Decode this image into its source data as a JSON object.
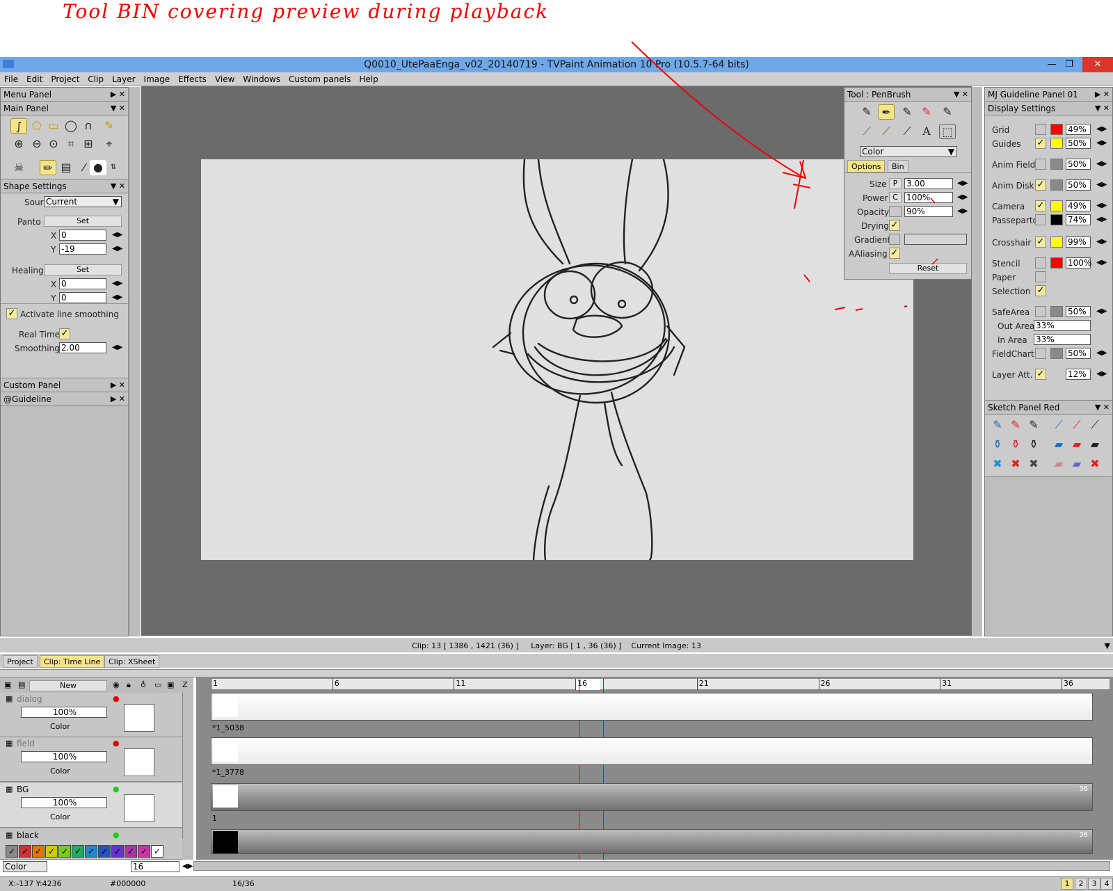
{
  "annotation": {
    "text": "Tool BIN covering preview during playback"
  },
  "window": {
    "title": "Q0010_UtePaaEnga_v02_20140719 - TVPaint Animation 10 Pro (10.5.7-64 bits)",
    "minimize": "—",
    "restore": "❐",
    "close": "✕"
  },
  "menu": [
    "File",
    "Edit",
    "Project",
    "Clip",
    "Layer",
    "Image",
    "Effects",
    "View",
    "Windows",
    "Custom panels",
    "Help"
  ],
  "left": {
    "menu_panel": "Menu Panel",
    "main_panel": "Main Panel",
    "shape_settings": "Shape Settings",
    "source_label": "Source",
    "source_value": "Current",
    "panto_label": "Panto",
    "panto_set": "Set",
    "panto_x": "0",
    "panto_y": "-19",
    "healing_label": "Healing",
    "healing_set": "Set",
    "healing_x": "0",
    "healing_y": "0",
    "x_label": "X",
    "y_label": "Y",
    "line_smoothing": "Activate line smoothing",
    "real_time": "Real Time",
    "smoothing_label": "Smoothing",
    "smoothing_value": "2.00",
    "custom_panel": "Custom Panel",
    "guideline": "@Guideline"
  },
  "tool_panel": {
    "title": "Tool : PenBrush",
    "mode": "Color",
    "tab_options": "Options",
    "tab_bin": "Bin",
    "size_label": "Size",
    "size_mode": "P",
    "size_value": "3.00",
    "power_label": "Power",
    "power_mode": "C",
    "power_value": "100%",
    "opacity_label": "Opacity",
    "opacity_value": "90%",
    "drying_label": "Drying",
    "gradient_label": "Gradient",
    "aaliasing_label": "AAliasing",
    "reset": "Reset"
  },
  "right": {
    "title": "MJ Guideline Panel 01",
    "display_settings": "Display Settings",
    "rows": [
      {
        "label": "Grid",
        "value": "49%",
        "color": "#ff0000"
      },
      {
        "label": "Guides",
        "value": "50%",
        "color": "#ffff00"
      },
      {
        "label": "Anim Field",
        "value": "50%",
        "color": "#8a8a8a"
      },
      {
        "label": "Anim Disk",
        "value": "50%",
        "color": "#8a8a8a"
      },
      {
        "label": "Camera",
        "value": "49%",
        "color": "#ffff00"
      },
      {
        "label": "Passepartout",
        "value": "74%",
        "color": "#000000"
      },
      {
        "label": "Crosshair",
        "value": "99%",
        "color": "#ffff00"
      },
      {
        "label": "Stencil",
        "value": "100%",
        "color": "#ff0000"
      },
      {
        "label": "Paper",
        "value": ""
      },
      {
        "label": "Selection",
        "value": ""
      },
      {
        "label": "SafeArea",
        "value": "50%",
        "color": "#8a8a8a"
      },
      {
        "label": "Out Area",
        "value": "33%"
      },
      {
        "label": "In Area",
        "value": "33%"
      },
      {
        "label": "FieldChart",
        "value": "50%",
        "color": "#8a8a8a"
      },
      {
        "label": "Layer Att.",
        "value": "12%"
      }
    ],
    "sketch_panel": "Sketch Panel Red"
  },
  "status": {
    "clip": "Clip: 13 [ 1386 , 1421  (36) ]",
    "layer": "Layer: BG [ 1 , 36  (36) ]",
    "current": "Current Image: 13"
  },
  "tabs": [
    "Project",
    "Clip: Time Line",
    "Clip: XSheet"
  ],
  "timeline": {
    "new_button": "New",
    "z_label": "Z",
    "ruler": [
      "1",
      "6",
      "11",
      "16",
      "21",
      "26",
      "31",
      "36"
    ],
    "layers": [
      {
        "name": "dialog",
        "opacity": "100%",
        "mode": "Color",
        "clip": "*1_5038"
      },
      {
        "name": "field",
        "opacity": "100%",
        "mode": "Color",
        "clip": "*1_3778"
      },
      {
        "name": "BG",
        "opacity": "100%",
        "mode": "Color",
        "clip": "1",
        "end": "36"
      },
      {
        "name": "black",
        "end": "36"
      }
    ],
    "color_mode": "Color",
    "frame_field": "16"
  },
  "bottom": {
    "coords": "X:-137 Y:4236",
    "color": "#000000",
    "frame": "16/36",
    "pages": [
      "1",
      "2",
      "3",
      "4"
    ]
  }
}
